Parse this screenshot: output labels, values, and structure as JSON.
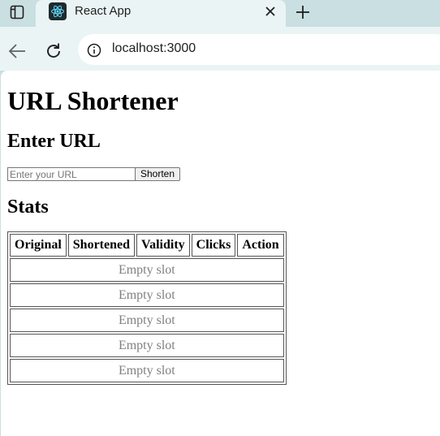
{
  "browser": {
    "tab_title": "React App",
    "url": "localhost:3000"
  },
  "page": {
    "title": "URL Shortener",
    "enter_heading": "Enter URL",
    "input_placeholder": "Enter your URL",
    "input_value": "",
    "shorten_button": "Shorten",
    "stats_heading": "Stats",
    "table": {
      "headers": [
        "Original",
        "Shortened",
        "Validity",
        "Clicks",
        "Action"
      ],
      "rows": [
        "Empty slot",
        "Empty slot",
        "Empty slot",
        "Empty slot",
        "Empty slot"
      ]
    }
  },
  "colors": {
    "chrome_bg": "#c9dfe2",
    "toolbar_bg": "#ebf4f5",
    "placeholder_text": "#808080"
  },
  "icons": {
    "tab_list": "tab-list-icon",
    "favicon": "react-logo-icon",
    "close": "close-icon",
    "new_tab": "plus-icon",
    "back": "back-arrow-icon",
    "reload": "reload-icon",
    "site_info": "info-icon"
  }
}
